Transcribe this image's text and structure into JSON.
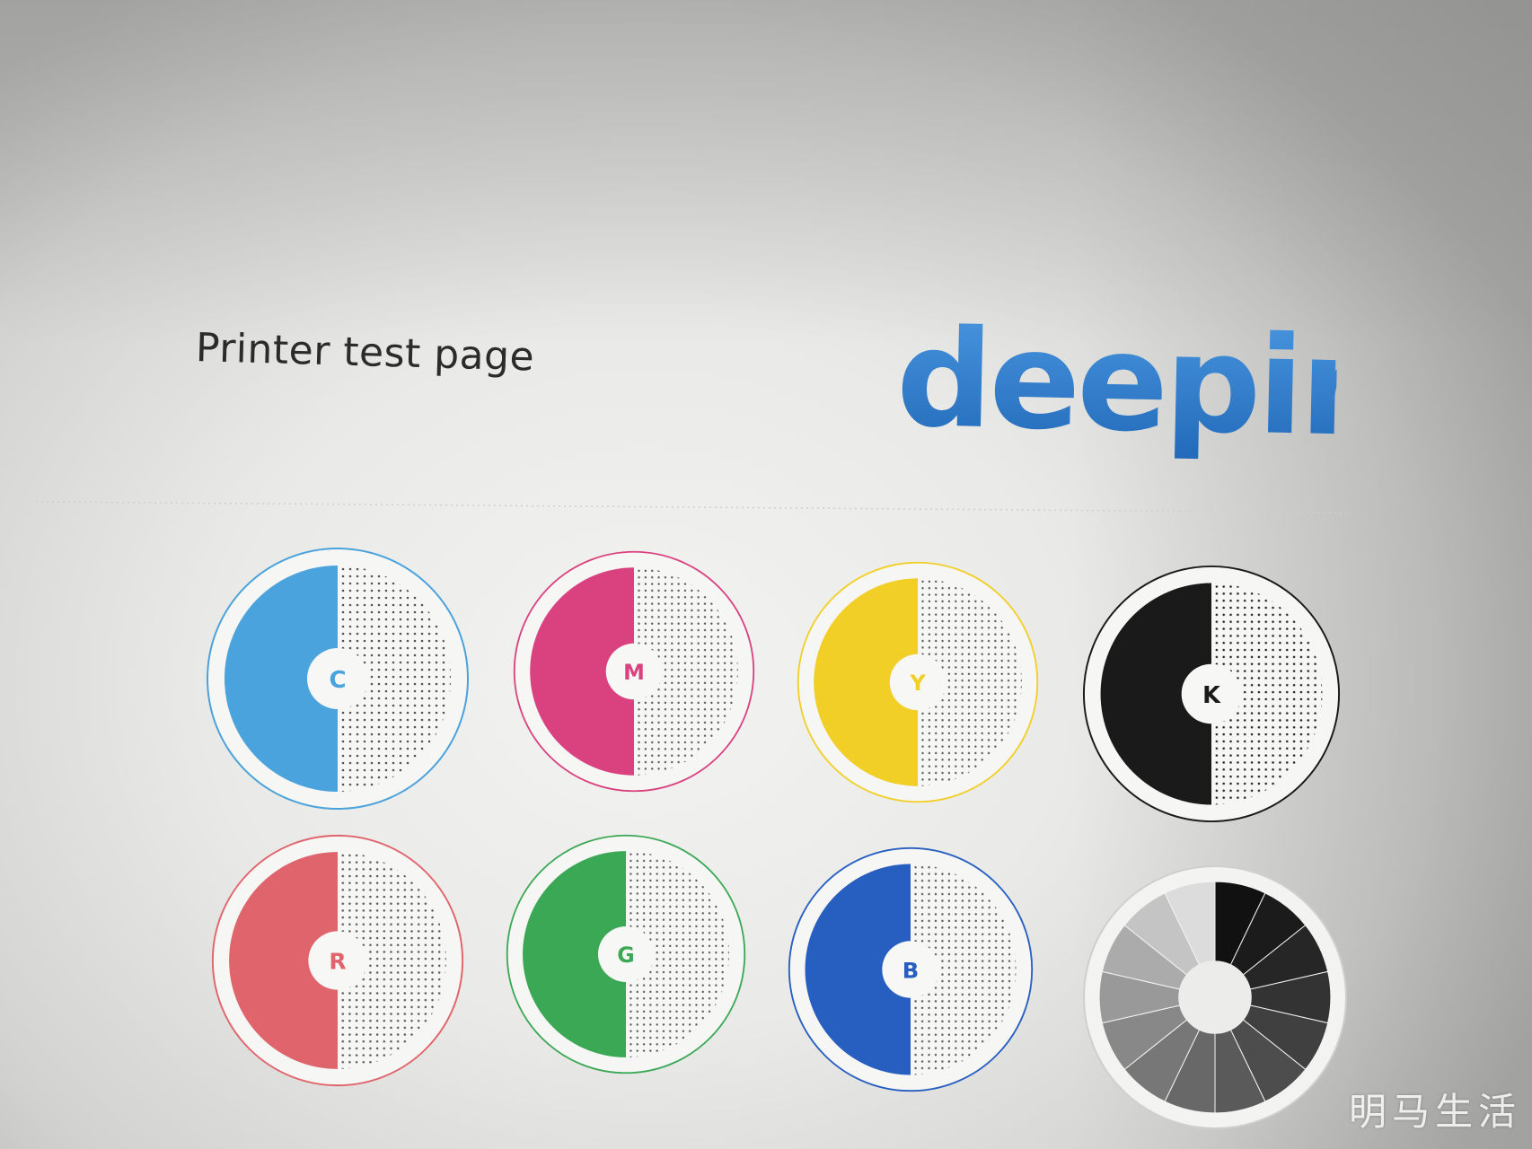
{
  "page": {
    "title": "Printer test page"
  },
  "logo": {
    "text": "deepin",
    "color": "#2f7fd0"
  },
  "swatches": [
    {
      "label": "C",
      "color": "#4aa3dc",
      "ring": "#4aa3dc"
    },
    {
      "label": "M",
      "color": "#d9427f",
      "ring": "#d9427f"
    },
    {
      "label": "Y",
      "color": "#f1cf27",
      "ring": "#f1cf27"
    },
    {
      "label": "K",
      "color": "#1a1a1a",
      "ring": "#1a1a1a"
    },
    {
      "label": "R",
      "color": "#e0646c",
      "ring": "#e0646c"
    },
    {
      "label": "G",
      "color": "#3ba856",
      "ring": "#3ba856"
    },
    {
      "label": "B",
      "color": "#275fc0",
      "ring": "#275fc0"
    }
  ],
  "grayscale_wheel": {
    "shades": [
      "#111111",
      "#1b1b1b",
      "#262626",
      "#333333",
      "#404040",
      "#4d4d4d",
      "#5a5a5a",
      "#686868",
      "#777777",
      "#888888",
      "#999999",
      "#ababab",
      "#c4c4c4",
      "#dcdcdc"
    ]
  },
  "watermark": "明马生活"
}
